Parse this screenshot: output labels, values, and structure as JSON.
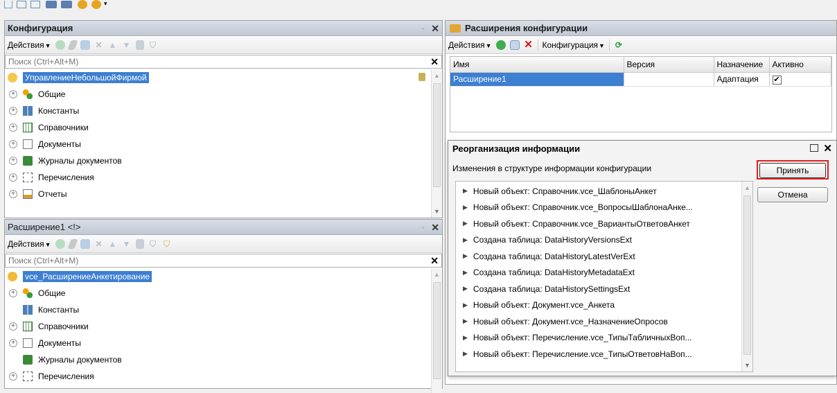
{
  "top_toolbar": {
    "icons": [
      "bracket-icon",
      "table-icon",
      "table-icon",
      "database-icon",
      "grid-icon",
      "play-icon",
      "play-icon",
      "dropdown-icon"
    ]
  },
  "config_panel": {
    "title": "Конфигурация",
    "actions_label": "Действия",
    "search_placeholder": "Поиск (Ctrl+Alt+M)",
    "root": "УправлениеНебольшойФирмой",
    "items": [
      {
        "label": "Общие",
        "icon": "common-icon"
      },
      {
        "label": "Константы",
        "icon": "constants-icon"
      },
      {
        "label": "Справочники",
        "icon": "catalogs-icon"
      },
      {
        "label": "Документы",
        "icon": "documents-icon"
      },
      {
        "label": "Журналы документов",
        "icon": "journals-icon"
      },
      {
        "label": "Перечисления",
        "icon": "enums-icon"
      },
      {
        "label": "Отчеты",
        "icon": "reports-icon"
      }
    ]
  },
  "extension_panel": {
    "title": "Расширение1 <!>",
    "actions_label": "Действия",
    "search_placeholder": "Поиск (Ctrl+Alt+M)",
    "root": "vce_РасширениеАнкетирование",
    "items": [
      {
        "label": "Общие",
        "icon": "common-icon",
        "expandable": true
      },
      {
        "label": "Константы",
        "icon": "constants-icon",
        "expandable": false
      },
      {
        "label": "Справочники",
        "icon": "catalogs-icon",
        "expandable": true
      },
      {
        "label": "Документы",
        "icon": "documents-icon",
        "expandable": true
      },
      {
        "label": "Журналы документов",
        "icon": "journals-icon",
        "expandable": false
      },
      {
        "label": "Перечисления",
        "icon": "enums-icon",
        "expandable": true
      }
    ]
  },
  "extensions_window": {
    "title": "Расширения конфигурации",
    "actions_label": "Действия",
    "configuration_label": "Конфигурация",
    "columns": [
      "Имя",
      "Версия",
      "Назначение",
      "Активно"
    ],
    "rows": [
      {
        "name": "Расширение1",
        "version": "",
        "purpose": "Адаптация",
        "active_mark": "✔"
      }
    ]
  },
  "reorg_dialog": {
    "title": "Реорганизация информации",
    "subtitle": "Изменения в структуре информации конфигурации",
    "accept_label": "Принять",
    "cancel_label": "Отмена",
    "items": [
      "Новый объект: Справочник.vce_ШаблоныАнкет",
      "Новый объект: Справочник.vce_ВопросыШаблонаАнке...",
      "Новый объект: Справочник.vce_ВариантыОтветовАнкет",
      "Создана таблица: DataHistoryVersionsExt",
      "Создана таблица: DataHistoryLatestVerExt",
      "Создана таблица: DataHistoryMetadataExt",
      "Создана таблица: DataHistorySettingsExt",
      "Новый объект: Документ.vce_Анкета",
      "Новый объект: Документ.vce_НазначениеОпросов",
      "Новый объект: Перечисление.vce_ТипыТабличныхВоп...",
      "Новый объект: Перечисление.vce_ТипыОтветовНаВоп..."
    ]
  },
  "colors": {
    "selection": "#3d7fd1",
    "highlight_border": "#e0201e"
  }
}
